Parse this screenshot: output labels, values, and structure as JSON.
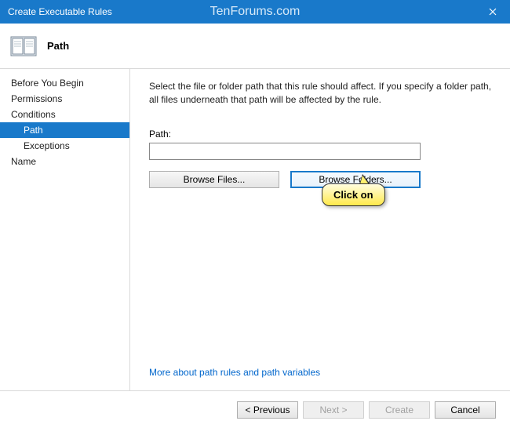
{
  "window": {
    "title": "Create Executable Rules",
    "watermark": "TenForums.com"
  },
  "header": {
    "title": "Path"
  },
  "nav": {
    "items": [
      {
        "label": "Before You Begin",
        "sub": false,
        "selected": false
      },
      {
        "label": "Permissions",
        "sub": false,
        "selected": false
      },
      {
        "label": "Conditions",
        "sub": false,
        "selected": false
      },
      {
        "label": "Path",
        "sub": true,
        "selected": true
      },
      {
        "label": "Exceptions",
        "sub": true,
        "selected": false
      },
      {
        "label": "Name",
        "sub": false,
        "selected": false
      }
    ]
  },
  "content": {
    "description": "Select the file or folder path that this rule should affect. If you specify a folder path, all files underneath that path will be affected by the rule.",
    "path_label": "Path:",
    "path_value": "",
    "browse_files": "Browse Files...",
    "browse_folders": "Browse Folders...",
    "more_link": "More about path rules and path variables"
  },
  "footer": {
    "previous": "< Previous",
    "next": "Next >",
    "create": "Create",
    "cancel": "Cancel"
  },
  "callout": {
    "text": "Click on"
  }
}
